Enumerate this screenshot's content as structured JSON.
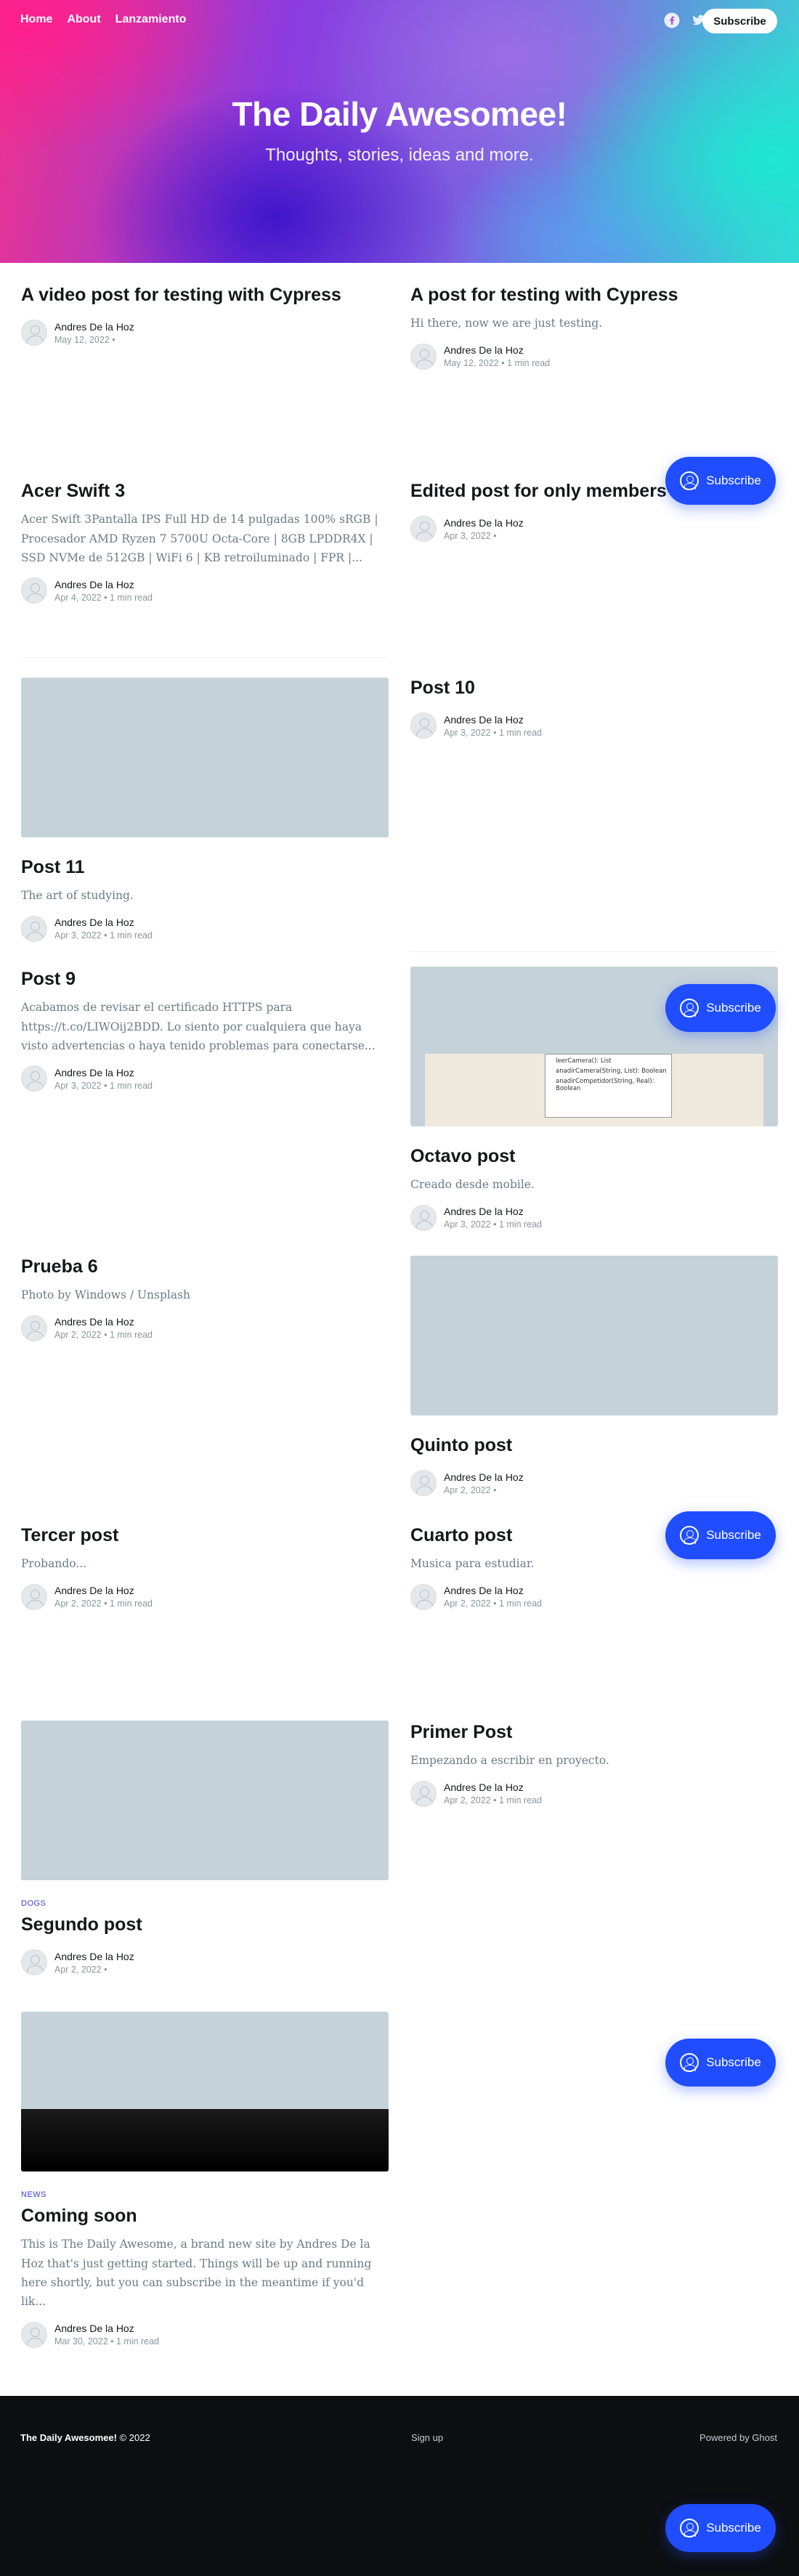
{
  "nav": {
    "items": [
      "Home",
      "About",
      "Lanzamiento"
    ]
  },
  "social": {
    "icons": [
      "facebook-icon",
      "twitter-icon"
    ]
  },
  "header_subscribe": "Subscribe",
  "site": {
    "title": "The Daily Awesomee!",
    "description": "Thoughts, stories, ideas and more."
  },
  "posts": [
    {
      "title": "A video post for testing with Cypress",
      "excerpt": "",
      "author": "Andres De la Hoz",
      "date": "May 12, 2022 •"
    },
    {
      "title": "A post for testing with Cypress",
      "excerpt": "Hi there, now we are just testing.",
      "author": "Andres De la Hoz",
      "date": "May 12, 2022  •  1 min read"
    },
    {
      "title": "Acer Swift 3",
      "excerpt": "Acer Swift 3Pantalla IPS Full HD de 14 pulgadas 100% sRGB | Procesador AMD Ryzen 7 5700U Octa-Core | 8GB LPDDR4X | SSD NVMe de 512GB | WiFi 6 | KB retroiluminado | FPR |...",
      "author": "Andres De la Hoz",
      "date": "Apr 4, 2022  •  1 min read"
    },
    {
      "title": "Edited post for only members",
      "excerpt": "",
      "author": "Andres De la Hoz",
      "date": "Apr 3, 2022 •"
    },
    {
      "title": "Post 10",
      "excerpt": "",
      "author": "Andres De la Hoz",
      "date": "Apr 3, 2022  •  1 min read"
    },
    {
      "title": "Post 11",
      "excerpt": "The art of studying.",
      "author": "Andres De la Hoz",
      "date": "Apr 3, 2022  •  1 min read"
    },
    {
      "title": "Post 9",
      "excerpt": "Acabamos de revisar el certificado HTTPS para https://t.co/LIWOij2BDD. Lo siento por cualquiera que haya visto advertencias o haya tenido problemas para conectarse...",
      "author": "Andres De la Hoz",
      "date": "Apr 3, 2022  •  1 min read"
    },
    {
      "title": "Octavo post",
      "excerpt": "Creado desde mobile.",
      "author": "Andres De la Hoz",
      "date": "Apr 3, 2022  •  1 min read"
    },
    {
      "title": "Prueba 6",
      "excerpt": "Photo by Windows / Unsplash",
      "author": "Andres De la Hoz",
      "date": "Apr 2, 2022  •  1 min read"
    },
    {
      "title": "Quinto post",
      "excerpt": "",
      "author": "Andres De la Hoz",
      "date": "Apr 2, 2022 •"
    },
    {
      "title": "Tercer post",
      "excerpt": "Probando...",
      "author": "Andres De la Hoz",
      "date": "Apr 2, 2022  •  1 min read"
    },
    {
      "title": "Cuarto post",
      "excerpt": "Musica para estudiar.",
      "author": "Andres De la Hoz",
      "date": "Apr 2, 2022  •  1 min read"
    },
    {
      "title": "Primer Post",
      "excerpt": "Empezando a escribir en proyecto.",
      "author": "Andres De la Hoz",
      "date": "Apr 2, 2022  •  1 min read"
    },
    {
      "title": "Segundo post",
      "tag": "DOGS",
      "excerpt": "",
      "author": "Andres De la Hoz",
      "date": "Apr 2, 2022 •"
    },
    {
      "title": "Coming soon",
      "tag": "NEWS",
      "excerpt": "This is The Daily Awesome, a brand new site by Andres De la Hoz that's just getting started. Things will be up and running here shortly, but you can subscribe in the meantime if you'd lik...",
      "author": "Andres De la Hoz",
      "date": "Mar 30, 2022  •  1 min read"
    }
  ],
  "uml_lines": [
    "leerCamera(): List",
    "anadirCamera(String, List): Boolean",
    "anadirCompetidor(String, Real): Boolean"
  ],
  "floating_subscribe": "Subscribe",
  "footer": {
    "site": "The Daily Awesomee!",
    "copyright": "© 2022",
    "signup": "Sign up",
    "powered": "Powered by Ghost"
  },
  "colors": {
    "accent": "#1f4dff",
    "footer_bg": "#0e0f11",
    "image_placeholder": "#c5d2da"
  }
}
